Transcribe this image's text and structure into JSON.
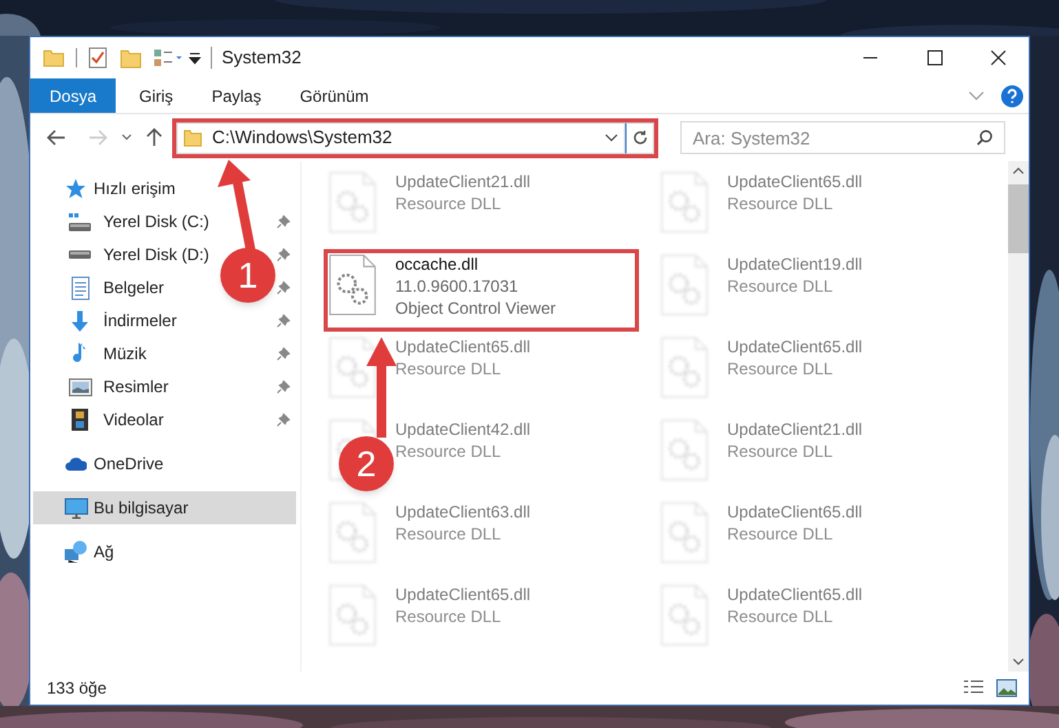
{
  "window": {
    "title": "System32"
  },
  "ribbon_tabs": [
    {
      "label": "Dosya",
      "kind": "file"
    },
    {
      "label": "Giriş",
      "kind": "tab"
    },
    {
      "label": "Paylaş",
      "kind": "tab"
    },
    {
      "label": "Görünüm",
      "kind": "tab"
    }
  ],
  "address_bar": {
    "path": "C:\\Windows\\System32",
    "highlighted": true
  },
  "search": {
    "placeholder": "Ara: System32"
  },
  "navigation": [
    {
      "label": "Hızlı erişim",
      "kind": "star",
      "selected": false,
      "children": [
        {
          "label": "Yerel Disk (C:)",
          "kind": "drive_system",
          "pinned": true
        },
        {
          "label": "Yerel Disk (D:)",
          "kind": "drive",
          "pinned": true
        },
        {
          "label": "Belgeler",
          "kind": "documents",
          "pinned": true
        },
        {
          "label": "İndirmeler",
          "kind": "downloads",
          "pinned": true
        },
        {
          "label": "Müzik",
          "kind": "music",
          "pinned": true
        },
        {
          "label": "Resimler",
          "kind": "pictures",
          "pinned": true
        },
        {
          "label": "Videolar",
          "kind": "videos",
          "pinned": true
        }
      ]
    },
    {
      "label": "OneDrive",
      "kind": "cloud",
      "selected": false
    },
    {
      "label": "Bu bilgisayar",
      "kind": "computer",
      "selected": true
    },
    {
      "label": "Ağ",
      "kind": "network",
      "selected": false
    }
  ],
  "files": [
    {
      "name": "UpdateClient21.dll",
      "details": [
        "Resource DLL"
      ],
      "blurred": true,
      "highlighted": false
    },
    {
      "name": "UpdateClient65.dll",
      "details": [
        "Resource DLL"
      ],
      "blurred": true,
      "highlighted": false
    },
    {
      "name": "occache.dll",
      "details": [
        "11.0.9600.17031",
        "Object Control Viewer"
      ],
      "blurred": false,
      "highlighted": true
    },
    {
      "name": "UpdateClient19.dll",
      "details": [
        "Resource DLL"
      ],
      "blurred": true,
      "highlighted": false
    },
    {
      "name": "UpdateClient65.dll",
      "details": [
        "Resource DLL"
      ],
      "blurred": true,
      "highlighted": false
    },
    {
      "name": "UpdateClient65.dll",
      "details": [
        "Resource DLL"
      ],
      "blurred": true,
      "highlighted": false
    },
    {
      "name": "UpdateClient42.dll",
      "details": [
        "Resource DLL"
      ],
      "blurred": true,
      "highlighted": false
    },
    {
      "name": "UpdateClient21.dll",
      "details": [
        "Resource DLL"
      ],
      "blurred": true,
      "highlighted": false
    },
    {
      "name": "UpdateClient63.dll",
      "details": [
        "Resource DLL"
      ],
      "blurred": true,
      "highlighted": false
    },
    {
      "name": "UpdateClient65.dll",
      "details": [
        "Resource DLL"
      ],
      "blurred": true,
      "highlighted": false
    },
    {
      "name": "UpdateClient65.dll",
      "details": [
        "Resource DLL"
      ],
      "blurred": true,
      "highlighted": false
    },
    {
      "name": "UpdateClient65.dll",
      "details": [
        "Resource DLL"
      ],
      "blurred": true,
      "highlighted": false
    }
  ],
  "status_bar": {
    "item_count": "133 öğe"
  },
  "annotations": [
    {
      "number": "1"
    },
    {
      "number": "2"
    }
  ]
}
